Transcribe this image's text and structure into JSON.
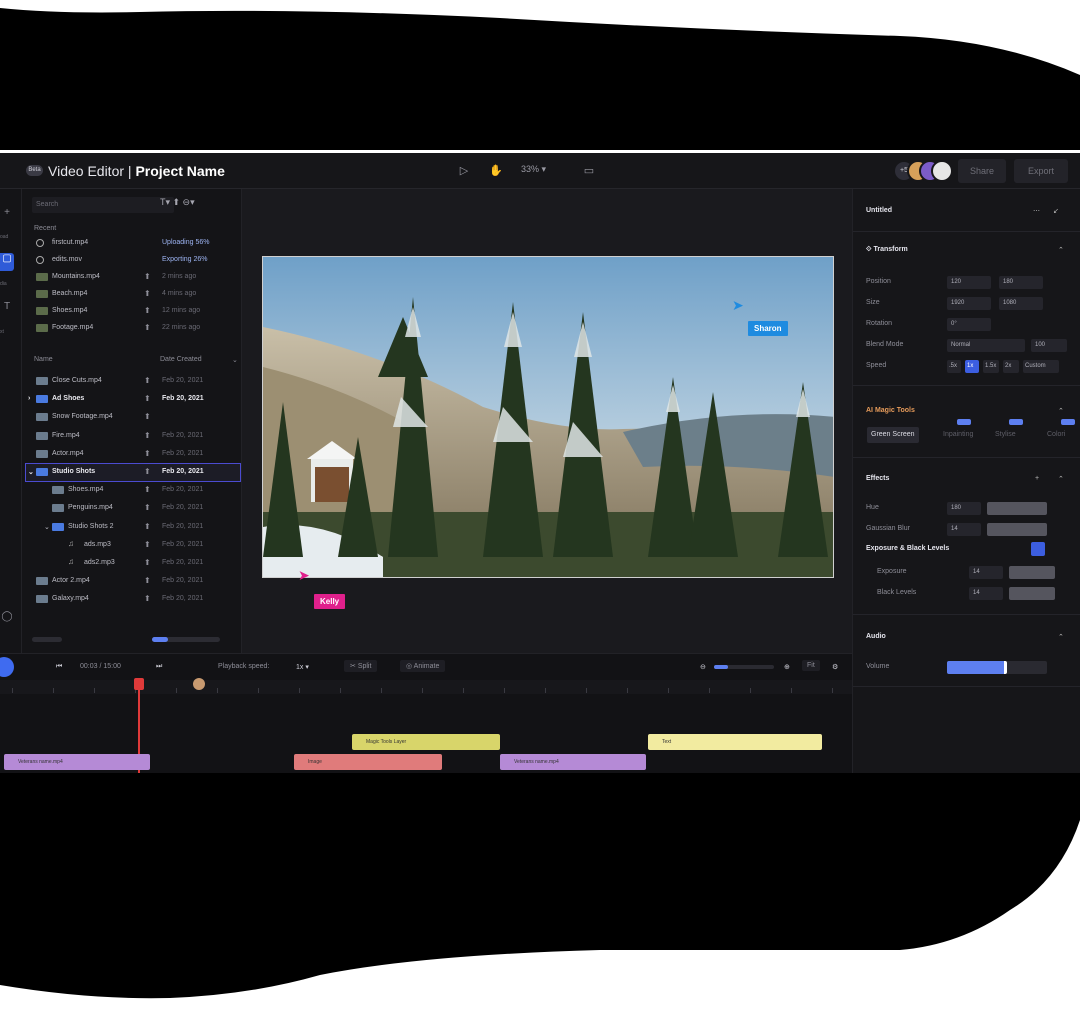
{
  "colors": {
    "accent": "#2f5bd8",
    "panel": "#141417",
    "kelly": "#e0208c",
    "sharon": "#1e8be0"
  },
  "topbar": {
    "beta": "Beta",
    "app_name": "Video Editor",
    "separator": " | ",
    "project_name": "Project Name",
    "zoom": "33% ▾",
    "collaborators_count": "+5",
    "share": "Share",
    "export": "Export"
  },
  "files": {
    "search_placeholder": "Search",
    "tools": "T▾  ⬆  ⊖▾",
    "recent_label": "Recent",
    "recent": [
      {
        "name": "firstcut.mp4",
        "meta": "Uploading 56%",
        "icon": "spinner-icon"
      },
      {
        "name": "edits.mov",
        "meta": "Exporting 26%",
        "icon": "spinner-icon"
      },
      {
        "name": "Mountains.mp4",
        "meta": "2 mins ago",
        "icon": "video-thumb-icon"
      },
      {
        "name": "Beach.mp4",
        "meta": "4 mins ago",
        "icon": "video-thumb-icon"
      },
      {
        "name": "Shoes.mp4",
        "meta": "12 mins ago",
        "icon": "video-thumb-icon"
      },
      {
        "name": "Footage.mp4",
        "meta": "22 mins ago",
        "icon": "video-thumb-icon"
      }
    ],
    "name_col": "Name",
    "date_col": "Date Created",
    "tree": [
      {
        "name": "Close Cuts.mp4",
        "meta": "Feb 20, 2021",
        "indent": 0,
        "type": "video"
      },
      {
        "name": "Ad Shoes",
        "meta": "Feb 20, 2021",
        "indent": 0,
        "type": "folder",
        "bold": true,
        "arrow": "›"
      },
      {
        "name": "Snow Footage.mp4",
        "meta": "",
        "indent": 0,
        "type": "video"
      },
      {
        "name": "Fire.mp4",
        "meta": "Feb 20, 2021",
        "indent": 0,
        "type": "video"
      },
      {
        "name": "Actor.mp4",
        "meta": "Feb 20, 2021",
        "indent": 0,
        "type": "video"
      },
      {
        "name": "Studio Shots",
        "meta": "Feb 20, 2021",
        "indent": 0,
        "type": "folder",
        "bold": true,
        "selected": true,
        "arrow": "⌄"
      },
      {
        "name": "Shoes.mp4",
        "meta": "Feb 20, 2021",
        "indent": 1,
        "type": "video"
      },
      {
        "name": "Penguins.mp4",
        "meta": "Feb 20, 2021",
        "indent": 1,
        "type": "video"
      },
      {
        "name": "Studio Shots 2",
        "meta": "Feb 20, 2021",
        "indent": 1,
        "type": "folder",
        "arrow": "⌄"
      },
      {
        "name": "ads.mp3",
        "meta": "Feb 20, 2021",
        "indent": 2,
        "type": "audio"
      },
      {
        "name": "ads2.mp3",
        "meta": "Feb 20, 2021",
        "indent": 2,
        "type": "audio"
      },
      {
        "name": "Actor 2.mp4",
        "meta": "Feb 20, 2021",
        "indent": 0,
        "type": "video"
      },
      {
        "name": "Galaxy.mp4",
        "meta": "Feb 20, 2021",
        "indent": 0,
        "type": "video"
      }
    ]
  },
  "preview": {
    "cursor_sharon": "Sharon",
    "cursor_kelly": "Kelly"
  },
  "inspector": {
    "title": "Untitled",
    "transform": {
      "label": "Transform",
      "position_label": "Position",
      "position_x": "120",
      "position_y": "180",
      "size_label": "Size",
      "size_w": "1920",
      "size_h": "1080",
      "rotation_label": "Rotation",
      "rotation": "0°",
      "blend_label": "Blend Mode",
      "blend": "Normal",
      "opacity": "100",
      "speed_label": "Speed",
      "speeds": [
        ".5x",
        "1x",
        "1.5x",
        "2x",
        "Custom"
      ],
      "speed_selected": 1
    },
    "magic": {
      "label": "AI Magic Tools",
      "tabs": [
        "Green Screen",
        "Inpainting",
        "Stylise",
        "Colori"
      ]
    },
    "effects": {
      "label": "Effects",
      "hue_label": "Hue",
      "hue": "180",
      "blur_label": "Gaussian Blur",
      "blur": "14",
      "exposure_group": "Exposure & Black Levels",
      "exposure_label": "Exposure",
      "exposure": "14",
      "black_label": "Black Levels",
      "black": "14"
    },
    "audio": {
      "label": "Audio",
      "volume_label": "Volume",
      "volume_level": 0.6
    }
  },
  "timeline": {
    "time": "00:03 / 15:00",
    "playback_label": "Playback speed:",
    "playback_value": "1x ▾",
    "split": "Split",
    "animate": "Animate",
    "fit": "Fit",
    "clips": {
      "magic": "Magic Tools Layer",
      "text": "Text",
      "video1": "Veterans name.mp4",
      "image": "Image",
      "video2": "Veterans name.mp4"
    }
  }
}
